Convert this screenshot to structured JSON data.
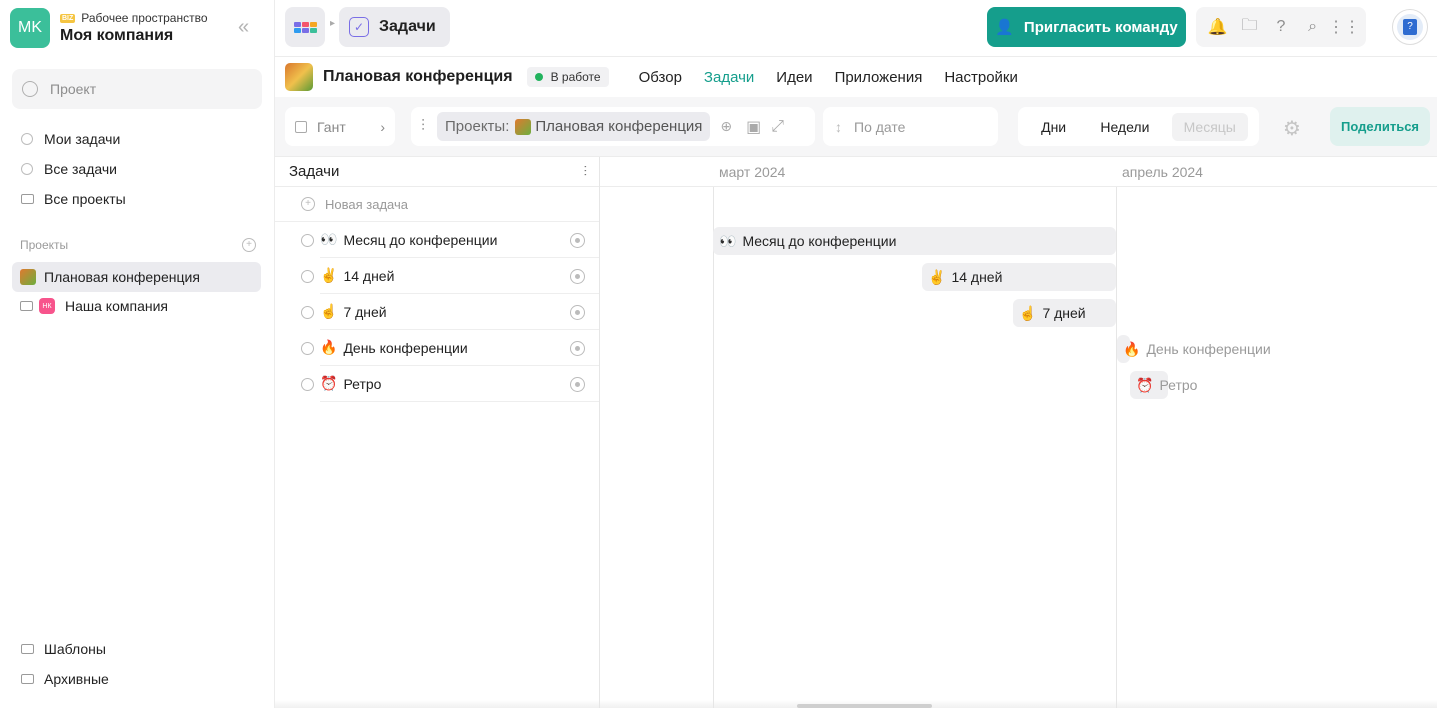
{
  "workspace": {
    "initials": "MK",
    "badge": "BIZ",
    "subtitle": "Рабочее пространство",
    "name": "Моя компания",
    "collapse_icon": "«"
  },
  "sidebar": {
    "search_placeholder": "Проект",
    "nav": [
      {
        "label": "Мои задачи",
        "icon": "check-circle-icon"
      },
      {
        "label": "Все задачи",
        "icon": "check-circle-icon"
      },
      {
        "label": "Все проекты",
        "icon": "folder-icon"
      }
    ],
    "projects_header": "Проекты",
    "projects": [
      {
        "label": "Плановая конференция",
        "active": true
      },
      {
        "label": "Наша компания",
        "badge": "НК"
      }
    ],
    "footer": [
      {
        "label": "Шаблоны",
        "icon": "templates-icon"
      },
      {
        "label": "Архивные",
        "icon": "archive-icon"
      }
    ]
  },
  "topbar": {
    "section_title": "Задачи",
    "invite_label": "Пригласить команду",
    "icons": [
      "bell-icon",
      "folder-icon",
      "help-icon",
      "search-icon",
      "apps-icon"
    ],
    "user_avatar_glyph": "?"
  },
  "project": {
    "title": "Плановая конференция",
    "status": "В работе",
    "tabs": [
      {
        "label": "Обзор",
        "active": false
      },
      {
        "label": "Задачи",
        "active": true
      },
      {
        "label": "Идеи",
        "active": false
      },
      {
        "label": "Приложения",
        "active": false
      },
      {
        "label": "Настройки",
        "active": false
      }
    ]
  },
  "toolbar": {
    "view_label": "Гант",
    "filter_prefix": "Проекты:",
    "filter_value": "Плановая конференция",
    "sort_label": "По дате",
    "scales": [
      {
        "label": "Дни",
        "disabled": false
      },
      {
        "label": "Недели",
        "disabled": false
      },
      {
        "label": "Месяцы",
        "disabled": true
      }
    ],
    "share_label": "Поделиться"
  },
  "tasklist": {
    "header": "Задачи",
    "new_task_label": "Новая задача",
    "tasks": [
      {
        "emoji": "👀",
        "name": "Месяц до конференции"
      },
      {
        "emoji": "✌️",
        "name": "14 дней"
      },
      {
        "emoji": "☝️",
        "name": "7 дней"
      },
      {
        "emoji": "🔥",
        "name": "День конференции"
      },
      {
        "emoji": "⏰",
        "name": "Ретро"
      }
    ]
  },
  "gantt": {
    "months": [
      "март 2024",
      "апрель 2024"
    ],
    "bars": [
      {
        "emoji": "👀",
        "name": "Месяц до конференции"
      },
      {
        "emoji": "✌️",
        "name": "14 дней"
      },
      {
        "emoji": "☝️",
        "name": "7 дней"
      },
      {
        "emoji": "🔥",
        "name": "День конференции"
      },
      {
        "emoji": "⏰",
        "name": "Ретро"
      }
    ]
  },
  "colors": {
    "accent": "#159e8c",
    "workspace_avatar": "#3bbf9a",
    "status_dot": "#22b35e",
    "task_icon": "#7a6ee6"
  }
}
